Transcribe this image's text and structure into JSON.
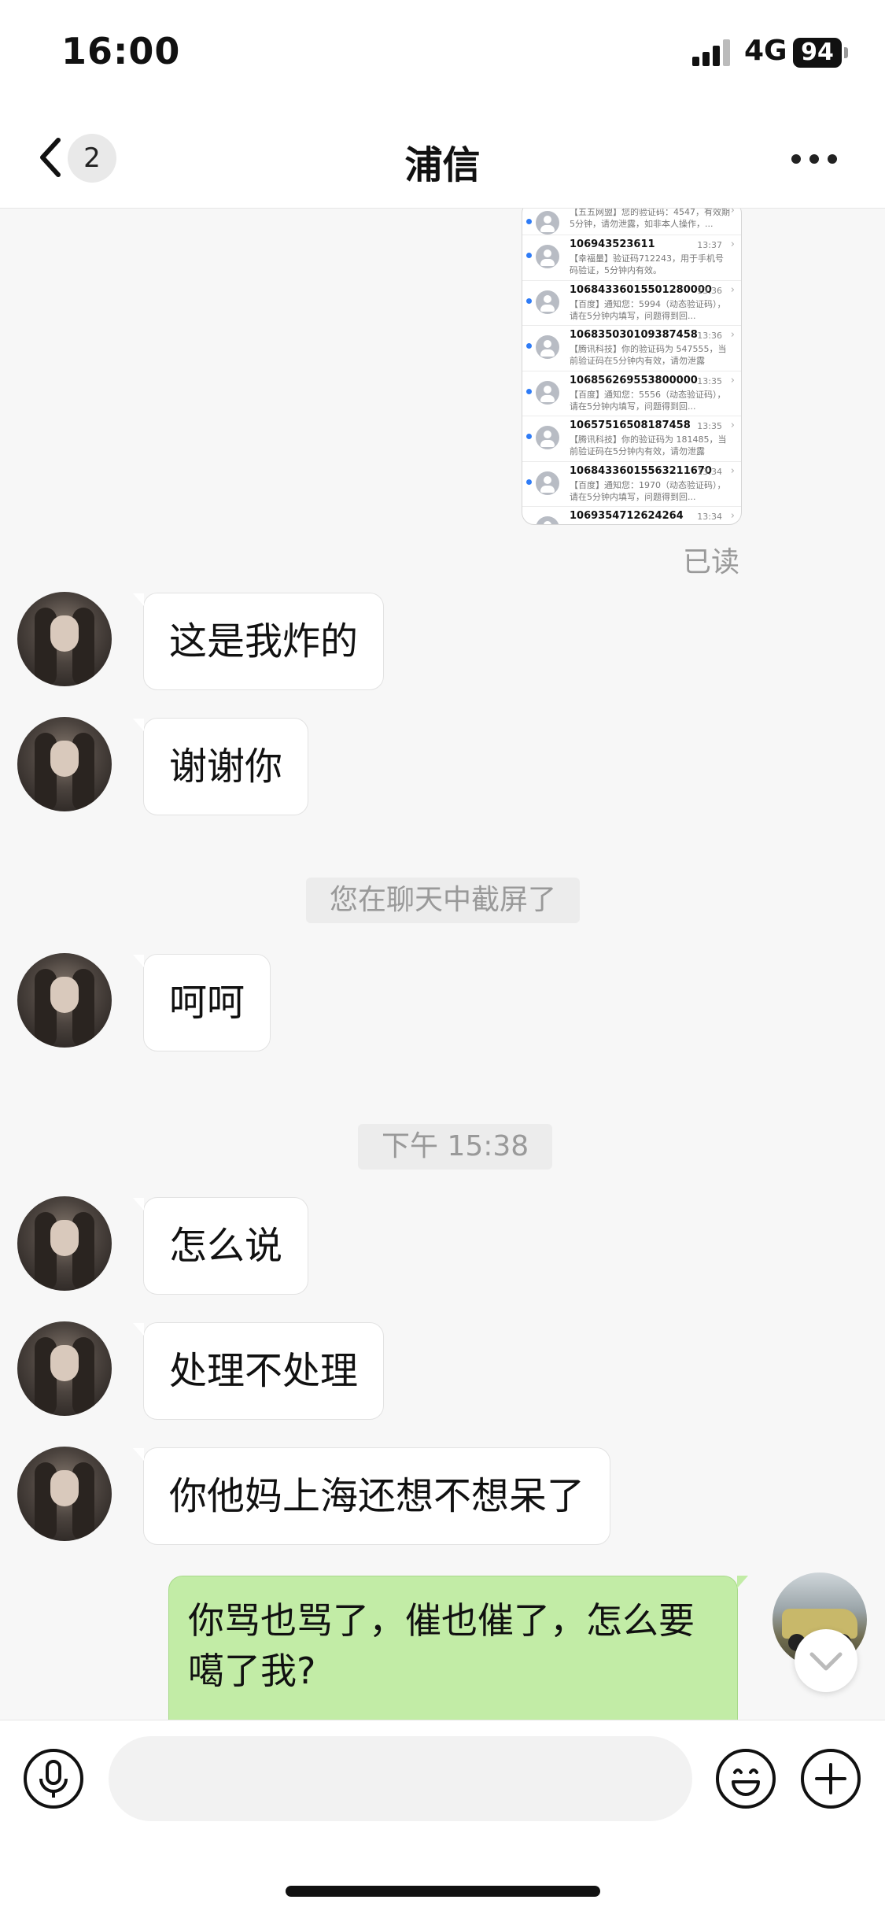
{
  "status": {
    "time": "16:00",
    "network": "4G",
    "battery": "94"
  },
  "nav": {
    "unread_count": "2",
    "title": "浦信"
  },
  "screenshot_sms": [
    {
      "number": "",
      "time": "",
      "preview": "【五五网盟】您的验证码：4547，有效期5分钟，请勿泄露，如非本人操作，..."
    },
    {
      "number": "106943523611",
      "time": "13:37",
      "preview": "【幸福量】验证码712243，用于手机号码验证，5分钟内有效。"
    },
    {
      "number": "10684336015501280000",
      "time": "13:36",
      "preview": "【百度】通知您：5994（动态验证码），请在5分钟内填写，问题得到回..."
    },
    {
      "number": "106835030109387458",
      "time": "13:36",
      "preview": "【腾讯科技】你的验证码为 547555，当前验证码在5分钟内有效，请勿泄露"
    },
    {
      "number": "106856269553800000",
      "time": "13:35",
      "preview": "【百度】通知您：5556（动态验证码），请在5分钟内填写，问题得到回..."
    },
    {
      "number": "10657516508187458",
      "time": "13:35",
      "preview": "【腾讯科技】你的验证码为 181485，当前验证码在5分钟内有效，请勿泄露"
    },
    {
      "number": "10684336015563211670",
      "time": "13:34",
      "preview": "【百度】通知您：1970（动态验证码），请在5分钟内填写，问题得到回..."
    },
    {
      "number": "1069354712624264",
      "time": "13:34",
      "preview": ""
    }
  ],
  "read_receipt": "已读",
  "messages": {
    "m1": "这是我炸的",
    "m2": "谢谢你",
    "sys1": "您在聊天中截屏了",
    "m3": "呵呵",
    "time1": "下午 15:38",
    "m4": "怎么说",
    "m5": "处理不处理",
    "m6": "你他妈上海还想不想呆了",
    "out1": "你骂也骂了，催也催了，怎么要噶了我?"
  },
  "icons": {
    "back": "chevron-left-icon",
    "more": "more-horizontal-icon",
    "voice": "microphone-icon",
    "emoji": "smiley-icon",
    "plus": "plus-icon",
    "scroll": "chevron-down-icon"
  },
  "colors": {
    "outgoing_bubble": "#c2eca6",
    "unread_dot": "#2f7cf6",
    "background": "#f7f7f7"
  }
}
